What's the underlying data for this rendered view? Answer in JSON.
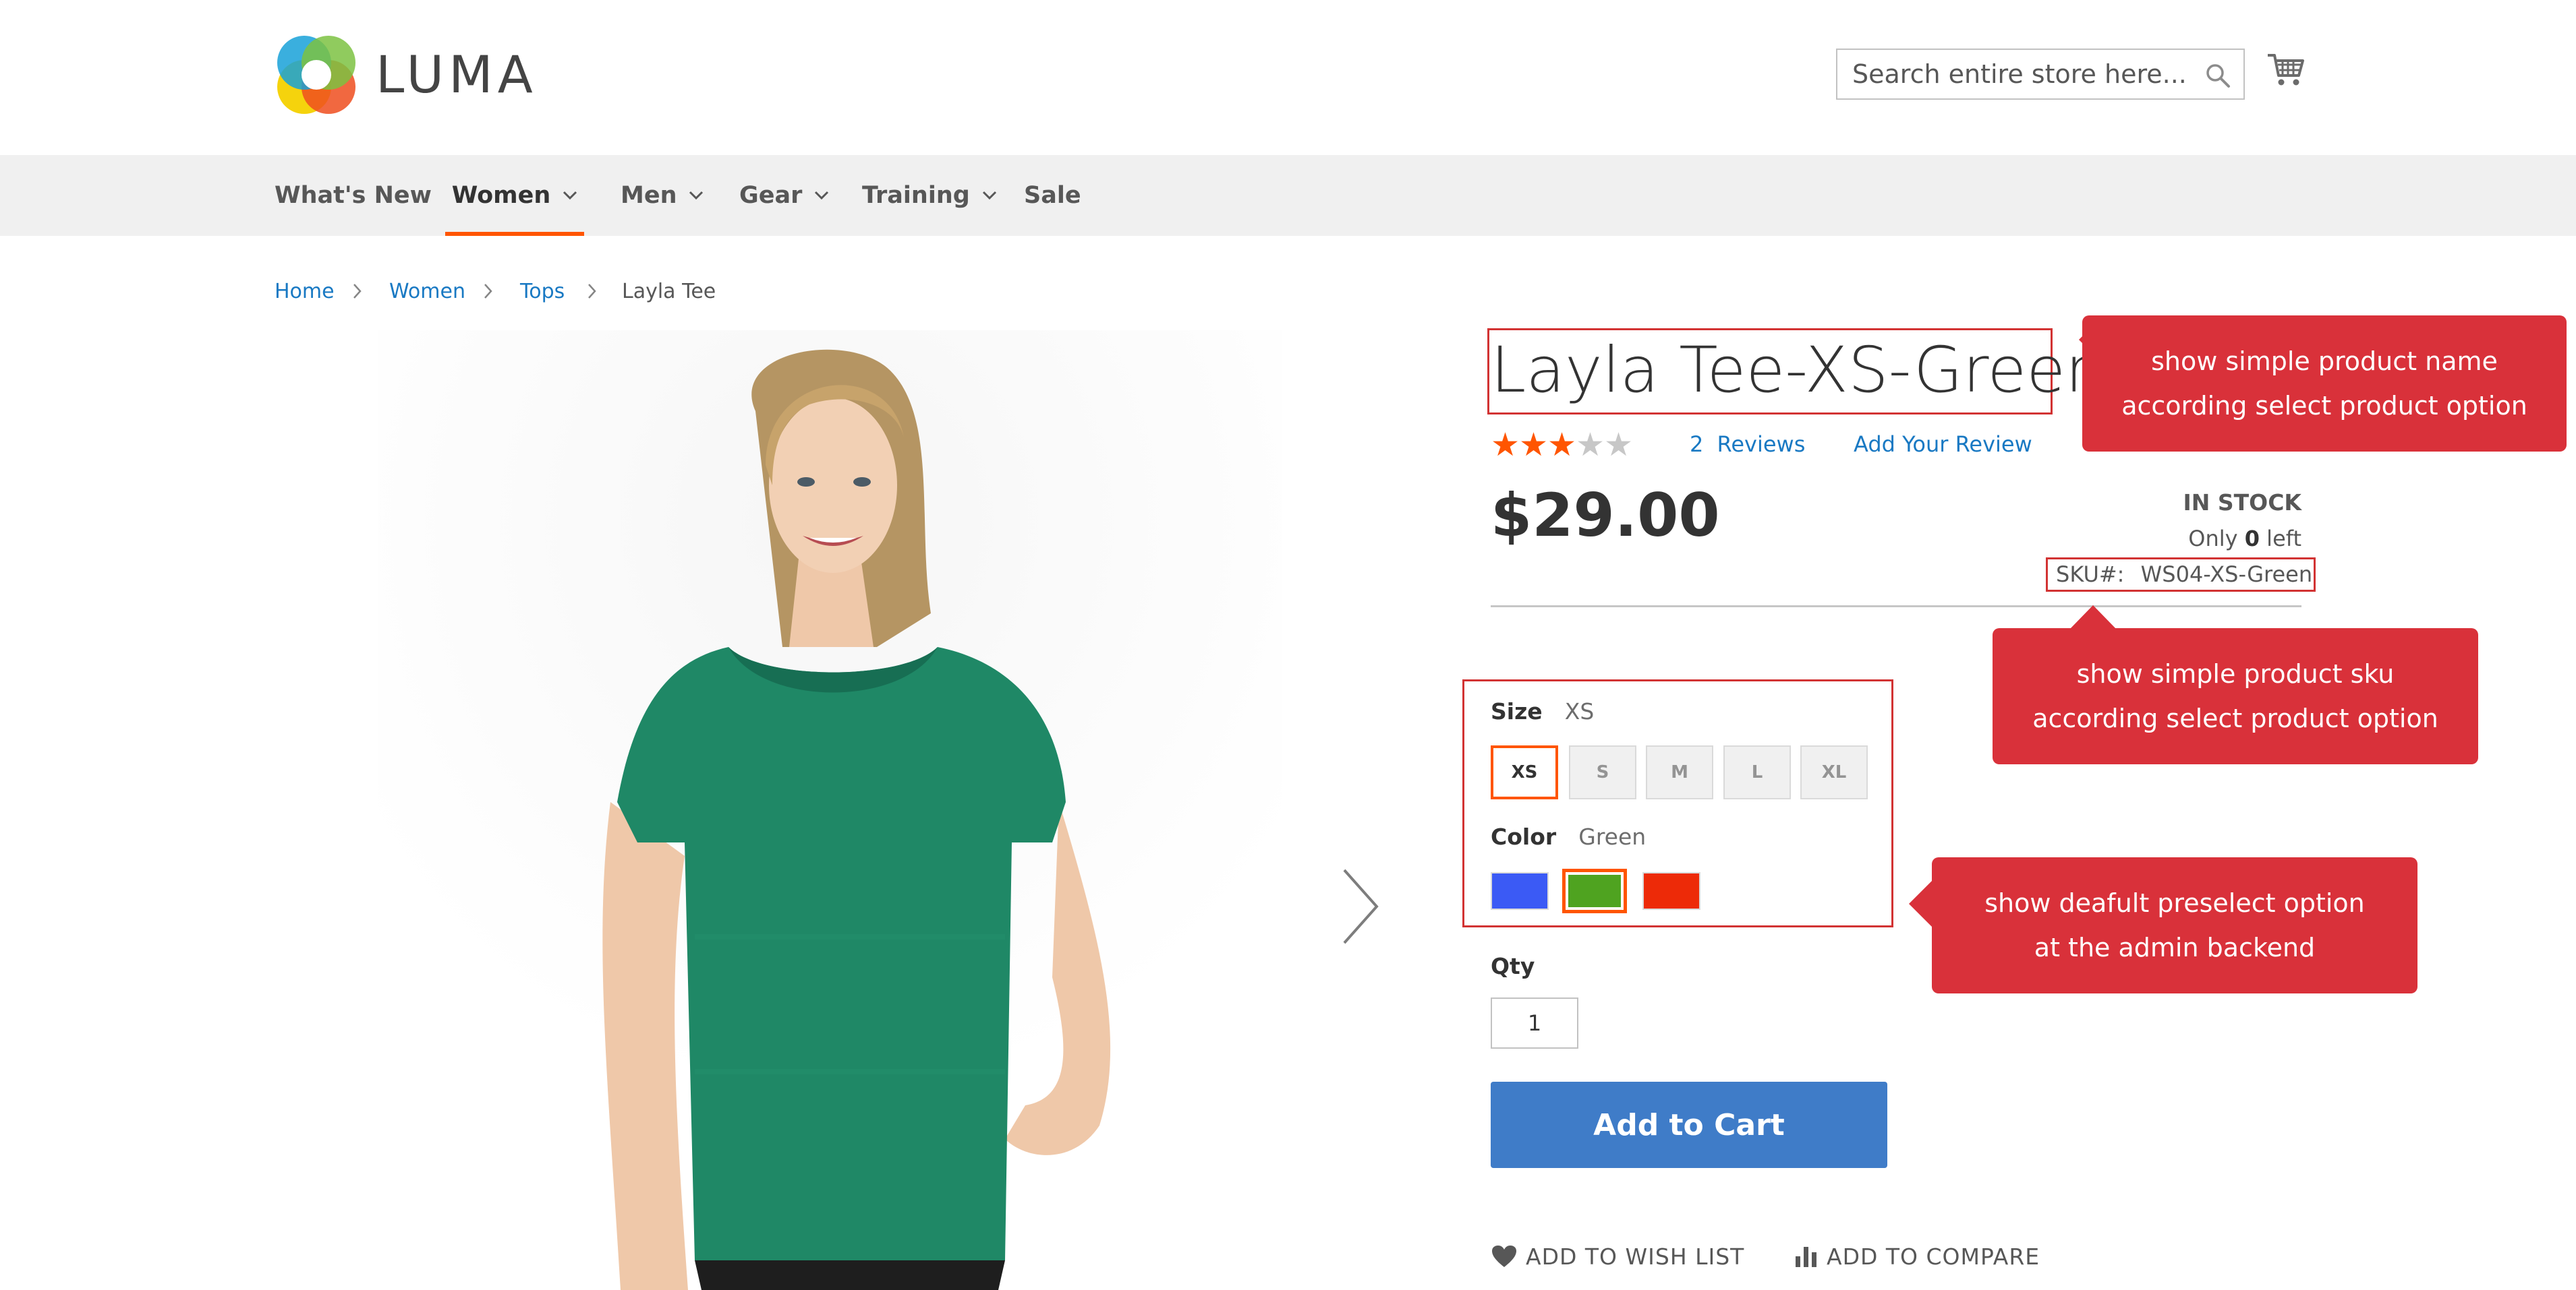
{
  "header": {
    "logo_text": "LUMA",
    "search_placeholder": "Search entire store here...",
    "icons": [
      "search-icon",
      "cart-icon"
    ]
  },
  "nav": {
    "items": [
      {
        "label": "What's New",
        "dropdown": false
      },
      {
        "label": "Women",
        "dropdown": true,
        "active": true
      },
      {
        "label": "Men",
        "dropdown": true
      },
      {
        "label": "Gear",
        "dropdown": true
      },
      {
        "label": "Training",
        "dropdown": true
      },
      {
        "label": "Sale",
        "dropdown": false
      }
    ]
  },
  "breadcrumb": {
    "items": [
      "Home",
      "Women",
      "Tops"
    ],
    "current": "Layla Tee"
  },
  "product": {
    "title": "Layla Tee-XS-Green",
    "rating_stars": 3,
    "rating_max": 5,
    "reviews_count": "2",
    "reviews_label": "Reviews",
    "add_review": "Add Your Review",
    "price": "$29.00",
    "stock": "IN STOCK",
    "only_prefix": "Only",
    "only_count": "0",
    "only_suffix": "left",
    "sku_label": "SKU#:",
    "sku": "WS04-XS-Green"
  },
  "options": {
    "size_label": "Size",
    "size_value": "XS",
    "sizes": [
      "XS",
      "S",
      "M",
      "L",
      "XL"
    ],
    "selected_size": "XS",
    "color_label": "Color",
    "color_value": "Green",
    "colors": [
      {
        "name": "Blue",
        "hex": "#3b5af5"
      },
      {
        "name": "Green",
        "hex": "#4fa320"
      },
      {
        "name": "Red",
        "hex": "#ed2a08"
      }
    ],
    "selected_color": "Green"
  },
  "purchase": {
    "qty_label": "Qty",
    "qty_value": "1",
    "add_to_cart": "Add to Cart",
    "wishlist": "ADD TO WISH LIST",
    "compare": "ADD TO COMPARE"
  },
  "callouts": {
    "name": [
      "show simple product name",
      "according select product option"
    ],
    "sku": [
      "show simple product sku",
      "according select product option"
    ],
    "default": [
      "show deafult preselect option",
      "at the admin backend"
    ]
  },
  "colors": {
    "link": "#1979c3",
    "accent": "#ff5501",
    "button": "#3f7cc8",
    "callout": "#d9313a",
    "star_on": "#ff5501",
    "star_off": "#c7c7c7"
  }
}
